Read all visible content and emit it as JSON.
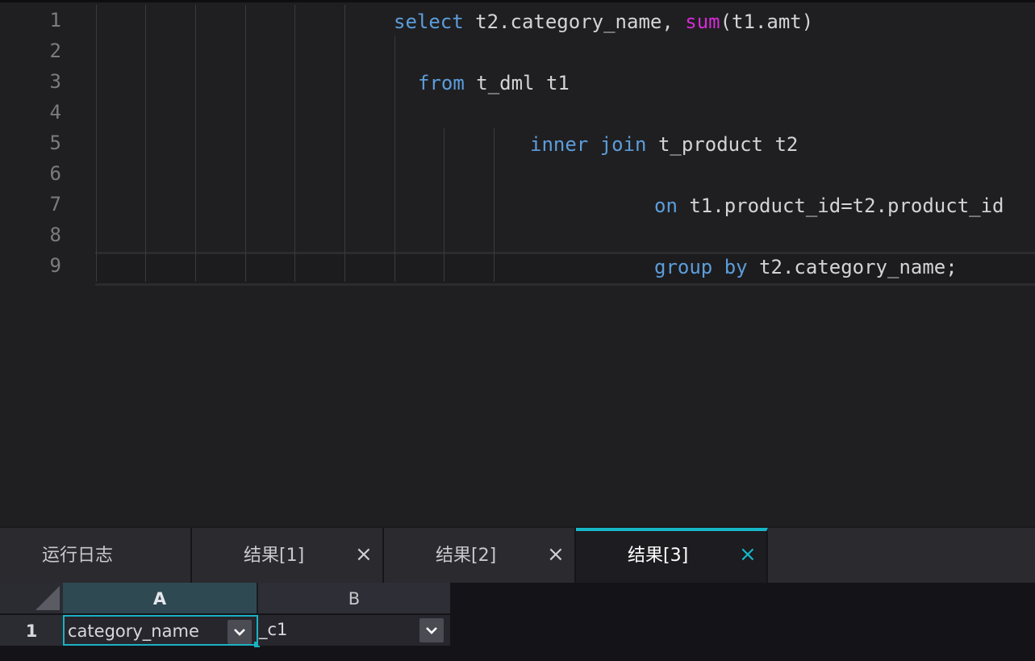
{
  "editor": {
    "line_numbers": [
      "1",
      "2",
      "3",
      "4",
      "5",
      "6",
      "7",
      "8",
      "9"
    ],
    "lines": [
      [
        {
          "t": "select",
          "k": "kw"
        },
        {
          "t": " t2.category_name, ",
          "k": ""
        },
        {
          "t": "sum",
          "k": "fn"
        },
        {
          "t": "(t1.amt)",
          "k": ""
        }
      ],
      [],
      [
        {
          "t": "from",
          "k": "kw"
        },
        {
          "t": " t_dml t1",
          "k": ""
        }
      ],
      [],
      [
        {
          "t": "inner",
          "k": "kw"
        },
        {
          "t": " ",
          "k": ""
        },
        {
          "t": "join",
          "k": "kw"
        },
        {
          "t": " t_product t2",
          "k": ""
        }
      ],
      [],
      [
        {
          "t": "on",
          "k": "kw"
        },
        {
          "t": " t1.product_id=t2.product_id",
          "k": ""
        }
      ],
      [],
      [
        {
          "t": "group",
          "k": "kw"
        },
        {
          "t": " ",
          "k": ""
        },
        {
          "t": "by",
          "k": "kw"
        },
        {
          "t": " t2.category_name;",
          "k": ""
        }
      ]
    ],
    "colors": {
      "keyword": "#5c9ddb",
      "function": "#d42bd6",
      "text": "#d4d4d6"
    }
  },
  "tabs": [
    {
      "label": "运行日志",
      "closable": false,
      "active": false
    },
    {
      "label": "结果[1]",
      "closable": true,
      "active": false,
      "close": "×"
    },
    {
      "label": "结果[2]",
      "closable": true,
      "active": false,
      "close": "×"
    },
    {
      "label": "结果[3]",
      "closable": true,
      "active": true,
      "close": "×"
    }
  ],
  "grid": {
    "columns": [
      "A",
      "B"
    ],
    "row_numbers": [
      "1"
    ],
    "rows": [
      [
        "category_name",
        "_c1"
      ]
    ],
    "accent": "#1bb1c4"
  }
}
